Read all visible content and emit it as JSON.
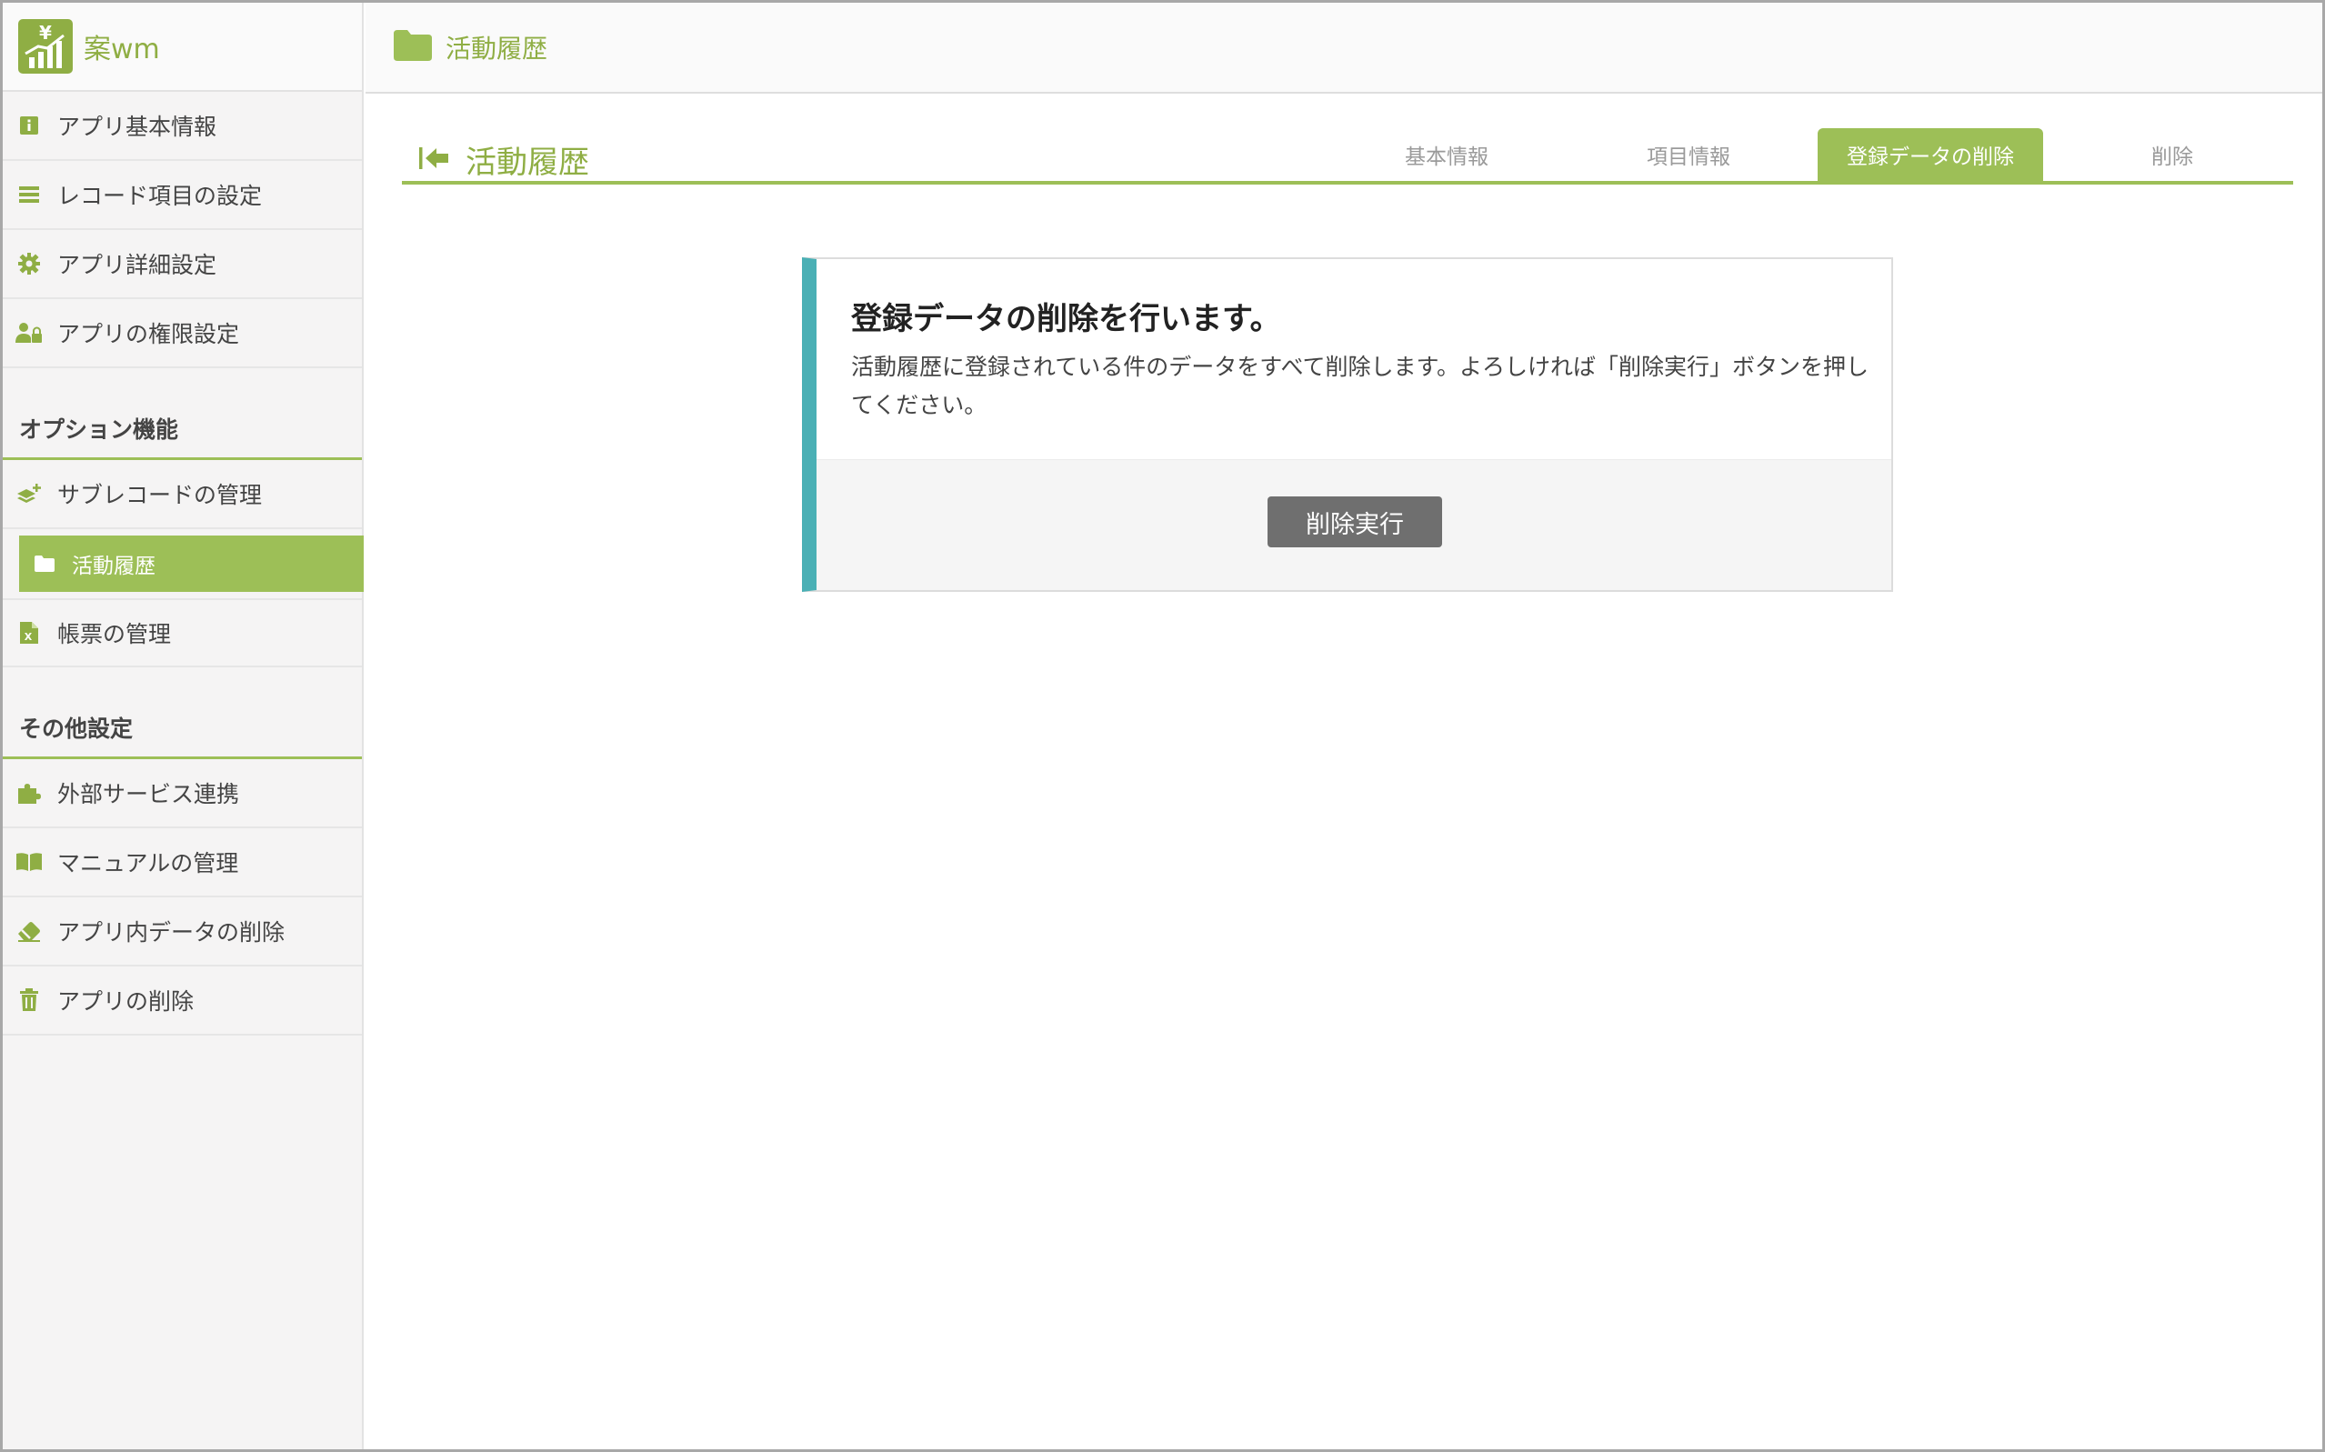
{
  "app": {
    "name": "案wm"
  },
  "header": {
    "title": "活動履歴"
  },
  "sidebar": {
    "items": [
      {
        "label": "アプリ基本情報"
      },
      {
        "label": "レコード項目の設定"
      },
      {
        "label": "アプリ詳細設定"
      },
      {
        "label": "アプリの権限設定"
      }
    ],
    "options_title": "オプション機能",
    "options": [
      {
        "label": "サブレコードの管理"
      },
      {
        "label": "活動履歴"
      },
      {
        "label": "帳票の管理"
      }
    ],
    "other_title": "その他設定",
    "other": [
      {
        "label": "外部サービス連携"
      },
      {
        "label": "マニュアルの管理"
      },
      {
        "label": "アプリ内データの削除"
      },
      {
        "label": "アプリの削除"
      }
    ]
  },
  "page": {
    "title": "活動履歴",
    "tabs": [
      {
        "label": "基本情報"
      },
      {
        "label": "項目情報"
      },
      {
        "label": "登録データの削除"
      },
      {
        "label": "削除"
      }
    ]
  },
  "card": {
    "title": "登録データの削除を行います。",
    "text": "活動履歴に登録されている件のデータをすべて削除します。よろしければ「削除実行」ボタンを押してください。",
    "button": "削除実行"
  },
  "colors": {
    "accent": "#9dbf57",
    "card_border": "#4ab0b5",
    "button": "#6f6f6f"
  }
}
